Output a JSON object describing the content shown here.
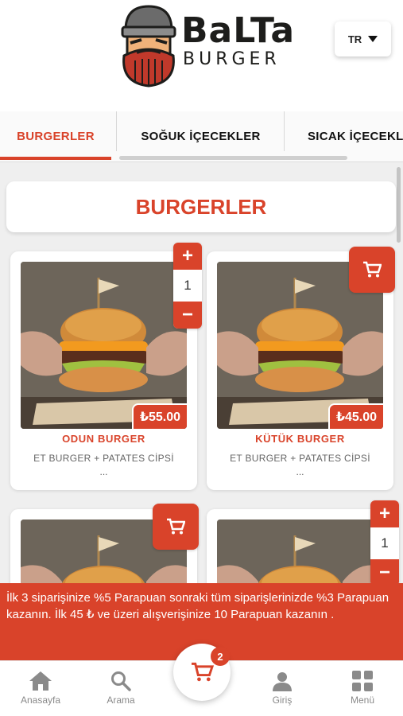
{
  "brand": {
    "line1": "BaLTa",
    "line2": "BURGER"
  },
  "language": {
    "value": "TR"
  },
  "tabs": [
    {
      "label": "BURGERLER"
    },
    {
      "label": "SOĞUK İÇECEKLER"
    },
    {
      "label": "SICAK İÇECEKL"
    }
  ],
  "category": {
    "title": "BURGERLER"
  },
  "products": [
    {
      "name": "ODUN BURGER",
      "description": "ET BURGER + PATATES CİPSİ",
      "more": "...",
      "price": "₺55.00",
      "quantity": "1"
    },
    {
      "name": "KÜTÜK BURGER",
      "description": "ET BURGER + PATATES CİPSİ",
      "more": "...",
      "price": "₺45.00"
    },
    {},
    {
      "quantity": "1"
    }
  ],
  "stepper": {
    "plus": "+",
    "minus": "−"
  },
  "promo": {
    "text": "İlk 3 siparişinize %5 Parapuan sonraki tüm siparişlerinizde %3 Parapuan kazanın. İlk 45 ₺ ve üzeri alışverişinize 10 Parapuan kazanın ."
  },
  "nav": {
    "home": "Anasayfa",
    "search": "Arama",
    "cart_count": "2",
    "login": "Giriş",
    "menu": "Menü"
  },
  "colors": {
    "accent": "#d9432a",
    "background": "#efefef"
  }
}
